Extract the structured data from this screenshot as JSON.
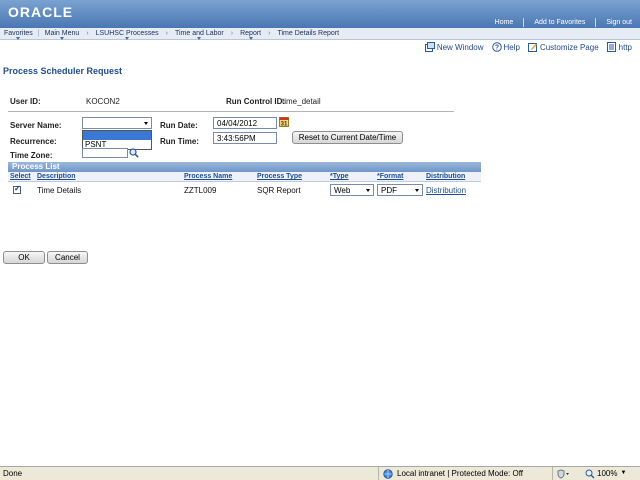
{
  "header": {
    "logo": "ORACLE",
    "links": [
      "Home",
      "Add to Favorites",
      "Sign out"
    ]
  },
  "nav": {
    "menus": [
      "Favorites",
      "Main Menu"
    ],
    "breadcrumbs": [
      "LSUHSC Processes",
      "Time and Labor",
      "Report",
      "Time Details Report"
    ]
  },
  "toolbar": {
    "new_window": "New Window",
    "help": "Help",
    "customize": "Customize Page",
    "http": "http"
  },
  "page": {
    "title": "Process Scheduler Request"
  },
  "form": {
    "user_id_label": "User ID:",
    "user_id": "KOCON2",
    "run_control_label": "Run Control ID:",
    "run_control": "time_detail",
    "server_name_label": "Server Name:",
    "server_name_value": "",
    "server_options": [
      "",
      "PSNT"
    ],
    "recurrence_label": "Recurrence:",
    "time_zone_label": "Time Zone:",
    "run_date_label": "Run Date:",
    "run_date": "04/04/2012",
    "run_time_label": "Run Time:",
    "run_time": "3:43:56PM",
    "reset_button": "Reset to Current Date/Time"
  },
  "process_list": {
    "title": "Process List",
    "columns": [
      "Select",
      "Description",
      "Process Name",
      "Process Type",
      "*Type",
      "*Format",
      "Distribution"
    ],
    "rows": [
      {
        "selected": true,
        "description": "Time Details",
        "process_name": "ZZTL009",
        "process_type": "SQR Report",
        "type": "Web",
        "format": "PDF",
        "distribution": "Distribution"
      }
    ]
  },
  "buttons": {
    "ok": "OK",
    "cancel": "Cancel"
  },
  "statusbar": {
    "status": "Done",
    "zone": "Local intranet | Protected Mode: Off",
    "zoom": "100%"
  },
  "colors": {
    "header_blue": "#4a77b3",
    "title_blue": "#1f4d8f",
    "selection_blue": "#3a78d4"
  }
}
